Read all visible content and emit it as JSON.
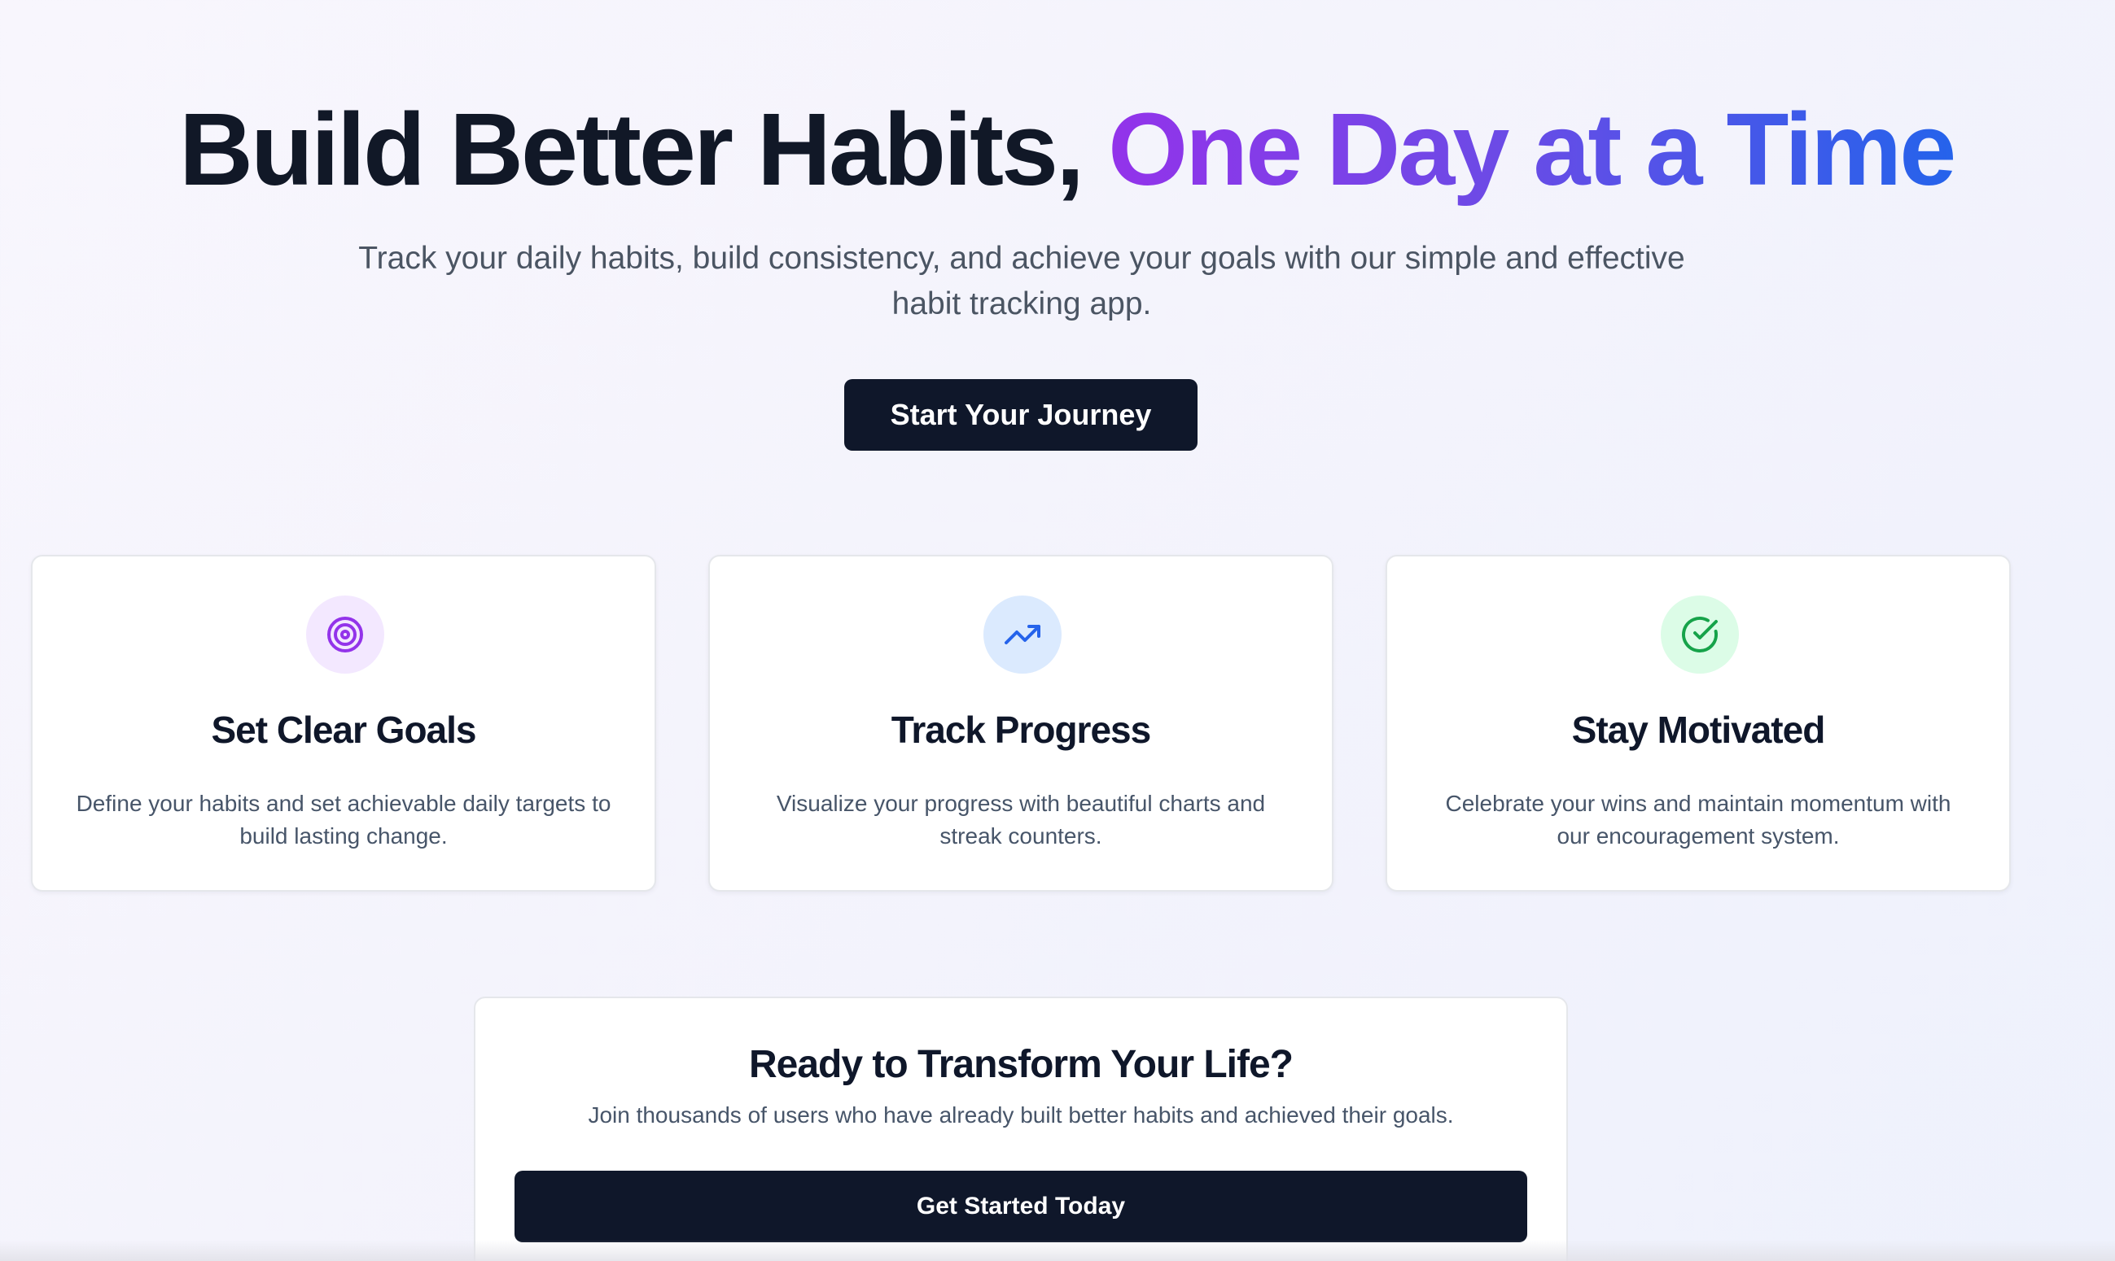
{
  "hero": {
    "title_plain": "Build Better Habits,",
    "title_highlight": "One Day at a Time",
    "subtitle": "Track your daily habits, build consistency, and achieve your goals with our simple and effective habit tracking app.",
    "cta_label": "Start Your Journey"
  },
  "features": [
    {
      "icon": "target-icon",
      "icon_color": "#9333ea",
      "icon_bg": "#f3e8ff",
      "title": "Set Clear Goals",
      "description": "Define your habits and set achievable daily targets to build lasting change."
    },
    {
      "icon": "trending-up-icon",
      "icon_color": "#2563eb",
      "icon_bg": "#dbeafe",
      "title": "Track Progress",
      "description": "Visualize your progress with beautiful charts and streak counters."
    },
    {
      "icon": "check-circle-icon",
      "icon_color": "#16a34a",
      "icon_bg": "#dcfce7",
      "title": "Stay Motivated",
      "description": "Celebrate your wins and maintain momentum with our encouragement system."
    }
  ],
  "cta": {
    "title": "Ready to Transform Your Life?",
    "text": "Join thousands of users who have already built better habits and achieved their goals.",
    "button_label": "Get Started Today"
  },
  "colors": {
    "dark": "#0f172a",
    "gradient_start": "#9333ea",
    "gradient_end": "#2563eb"
  }
}
